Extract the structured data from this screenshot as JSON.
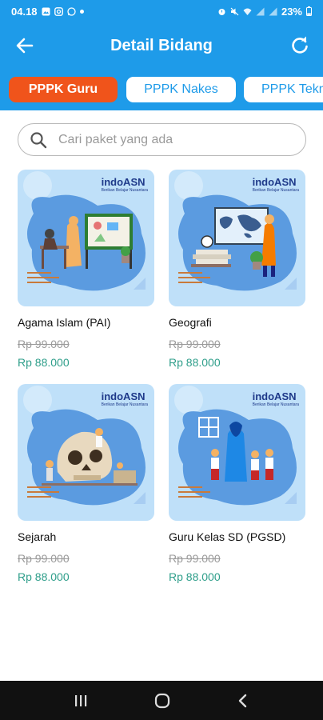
{
  "status_bar": {
    "time": "04.18",
    "battery": "23%"
  },
  "header": {
    "title": "Detail Bidang"
  },
  "tabs": [
    {
      "label": "PPPK Guru",
      "active": true
    },
    {
      "label": "PPPK Nakes",
      "active": false
    },
    {
      "label": "PPPK Tekn",
      "active": false
    }
  ],
  "search": {
    "placeholder": "Cari paket yang ada"
  },
  "packages": [
    {
      "name": "Agama Islam (PAI)",
      "old_price": "Rp 99.000",
      "price": "Rp 88.000",
      "logo": "indoASN",
      "logo_tagline": "Berikan Belajar Nusantara"
    },
    {
      "name": "Geografi",
      "old_price": "Rp 99.000",
      "price": "Rp 88.000",
      "logo": "indoASN",
      "logo_tagline": "Berikan Belajar Nusantara"
    },
    {
      "name": "Sejarah",
      "old_price": "Rp 99.000",
      "price": "Rp 88.000",
      "logo": "indoASN",
      "logo_tagline": "Berikan Belajar Nusantara"
    },
    {
      "name": "Guru Kelas SD (PGSD)",
      "old_price": "Rp 99.000",
      "price": "Rp 88.000",
      "logo": "indoASN",
      "logo_tagline": "Berikan Belajar Nusantara"
    }
  ],
  "colors": {
    "primary": "#1e9be9",
    "active_tab": "#f0541b",
    "price": "#2e9e8a",
    "old_price": "#9a9a9a"
  },
  "icons": {
    "back": "arrow-left-icon",
    "refresh": "refresh-icon",
    "search": "search-icon",
    "nav_recent": "recent-apps-icon",
    "nav_home": "home-icon",
    "nav_back": "nav-back-icon"
  }
}
